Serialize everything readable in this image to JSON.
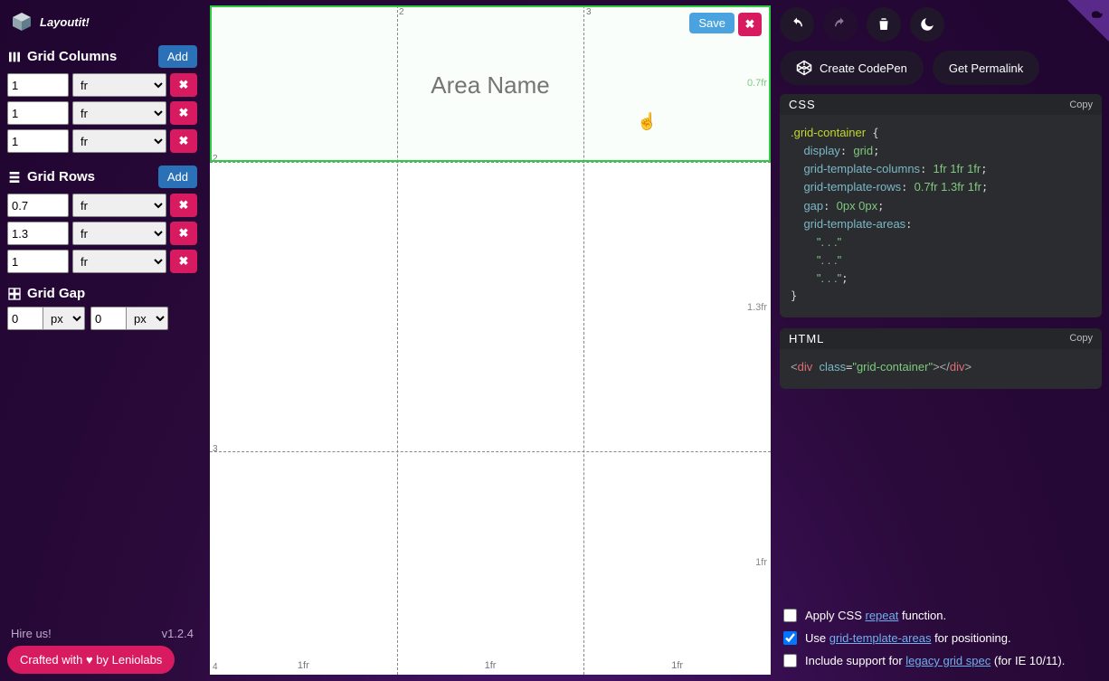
{
  "app": {
    "title": "Layoutit!"
  },
  "sidebar": {
    "columns": {
      "title": "Grid Columns",
      "add_label": "Add",
      "rows": [
        {
          "value": "1",
          "unit": "fr"
        },
        {
          "value": "1",
          "unit": "fr"
        },
        {
          "value": "1",
          "unit": "fr"
        }
      ]
    },
    "rows": {
      "title": "Grid Rows",
      "add_label": "Add",
      "rows": [
        {
          "value": "0.7",
          "unit": "fr"
        },
        {
          "value": "1.3",
          "unit": "fr"
        },
        {
          "value": "1",
          "unit": "fr"
        }
      ]
    },
    "gap": {
      "title": "Grid Gap",
      "col": {
        "value": "0",
        "unit": "px"
      },
      "row": {
        "value": "0",
        "unit": "px"
      }
    },
    "footer": {
      "hire": "Hire us!",
      "version": "v1.2.4",
      "crafted": "Crafted with ♥ by Leniolabs"
    }
  },
  "canvas": {
    "col_markers": [
      "2",
      "3"
    ],
    "row_markers": [
      "2",
      "3",
      "4"
    ],
    "row_sizes": [
      "0.7fr",
      "1.3fr",
      "1fr"
    ],
    "col_sizes": [
      "1fr",
      "1fr",
      "1fr"
    ],
    "area_placeholder": "Area Name",
    "save_label": "Save"
  },
  "right": {
    "codepen_label": "Create CodePen",
    "permalink_label": "Get Permalink",
    "css_head": "CSS",
    "html_head": "HTML",
    "copy_label": "Copy",
    "css_lines": {
      "sel": ".grid-container",
      "display": "grid",
      "cols": "1fr 1fr 1fr",
      "rows": "0.7fr 1.3fr 1fr",
      "gap": "0px 0px",
      "area1": "\". . .\"",
      "area2": "\". . .\"",
      "area3": "\". . .\""
    },
    "html_class": "grid-container"
  },
  "options": {
    "repeat": {
      "pre": "Apply CSS ",
      "link": "repeat",
      "post": " function.",
      "checked": false
    },
    "areas": {
      "pre": "Use ",
      "link": "grid-template-areas",
      "post": " for positioning.",
      "checked": true
    },
    "legacy": {
      "pre": "Include support for ",
      "link": "legacy grid spec",
      "post": " (for IE 10/11).",
      "checked": false
    }
  }
}
